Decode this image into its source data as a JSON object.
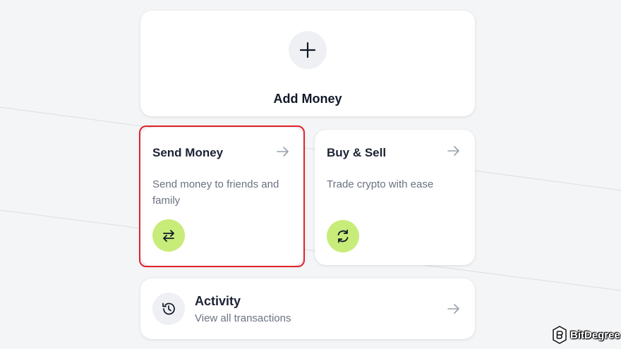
{
  "add_money": {
    "label": "Add Money",
    "icon": "plus-icon"
  },
  "send_money": {
    "title": "Send Money",
    "description": "Send money to friends and family",
    "icon": "swap-arrows-icon",
    "highlight_color": "#e3222d"
  },
  "buy_sell": {
    "title": "Buy & Sell",
    "description": "Trade crypto with ease",
    "icon": "refresh-icon"
  },
  "activity": {
    "title": "Activity",
    "description": "View all transactions",
    "icon": "history-icon"
  },
  "watermark": {
    "brand": "BitDegree"
  },
  "colors": {
    "accent_green": "#c8ec7a",
    "icon_bg": "#eef0f3",
    "page_bg": "#f4f5f7"
  }
}
